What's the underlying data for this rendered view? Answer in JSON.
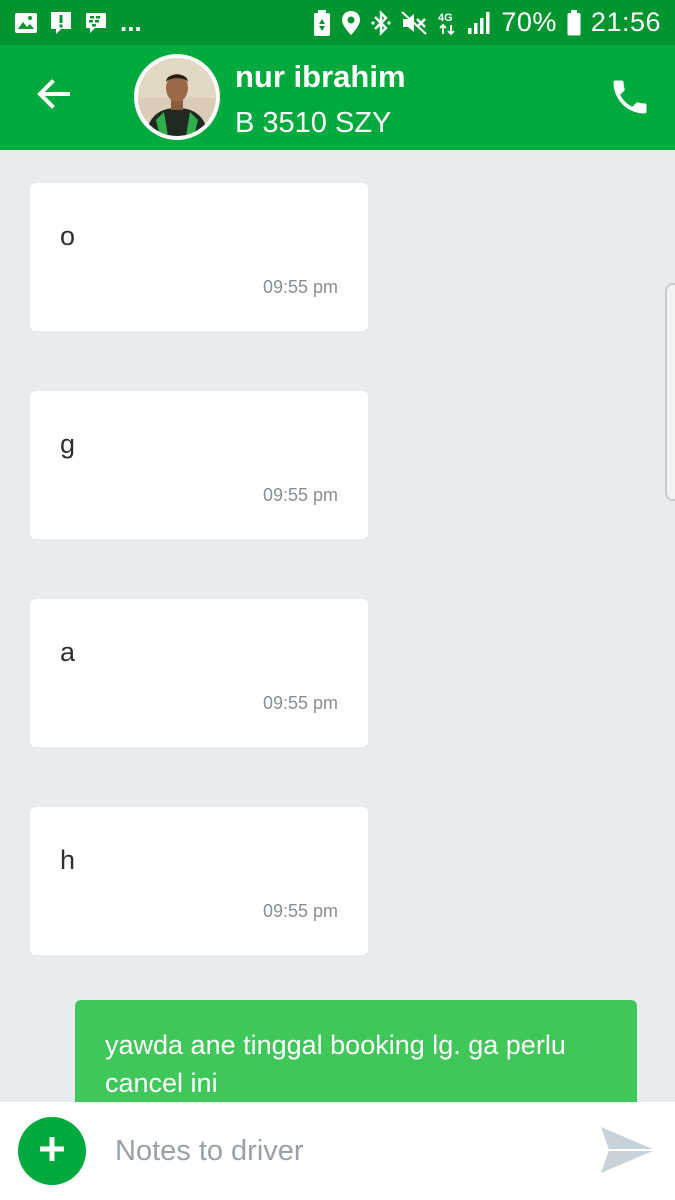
{
  "status_bar": {
    "left_icons": [
      "image-icon",
      "alert-icon",
      "bbm-icon"
    ],
    "overflow": "...",
    "right_icons": [
      "battery-saver-icon",
      "location-icon",
      "bluetooth-icon",
      "mute-icon",
      "network-4g-icon",
      "signal-icon"
    ],
    "battery_percent": "70%",
    "time": "21:56"
  },
  "header": {
    "driver_name": "nur ibrahim",
    "plate_number": "B 3510 SZY",
    "back_icon": "arrow-left-icon",
    "call_icon": "phone-icon"
  },
  "messages": [
    {
      "direction": "incoming",
      "text": "o",
      "time": "09:55 pm"
    },
    {
      "direction": "incoming",
      "text": "g",
      "time": "09:55 pm"
    },
    {
      "direction": "incoming",
      "text": "a",
      "time": "09:55 pm"
    },
    {
      "direction": "incoming",
      "text": "h",
      "time": "09:55 pm"
    },
    {
      "direction": "outgoing",
      "text": "yawda ane tinggal booking lg. ga perlu cancel ini"
    }
  ],
  "composer": {
    "placeholder": "Notes to driver",
    "add_icon": "plus-icon",
    "send_icon": "send-icon"
  },
  "colors": {
    "status_bar": "#00952f",
    "header": "#00aa3c",
    "chat_background": "#e8ecef",
    "outgoing_bubble": "#3fc75a",
    "incoming_bubble": "#ffffff"
  }
}
